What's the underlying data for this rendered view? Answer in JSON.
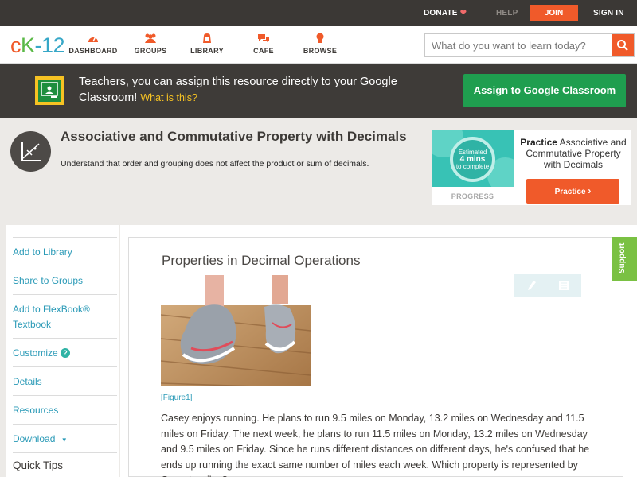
{
  "topbar": {
    "donate": "DONATE",
    "help": "HELP",
    "join": "JOIN",
    "signin": "SIGN IN"
  },
  "nav": {
    "logo": {
      "c": "c",
      "k": "K",
      "dash": "-",
      "n": "12"
    },
    "items": [
      {
        "label": "DASHBOARD",
        "icon": "speedometer-icon"
      },
      {
        "label": "GROUPS",
        "icon": "people-icon"
      },
      {
        "label": "LIBRARY",
        "icon": "book-bag-icon"
      },
      {
        "label": "CAFE",
        "icon": "chat-bubbles-icon"
      },
      {
        "label": "BROWSE",
        "icon": "lightbulb-icon"
      }
    ],
    "search_placeholder": "What do you want to learn today?"
  },
  "banner": {
    "text": "Teachers, you can assign this resource directly to your Google Classroom!",
    "what": "What is this?",
    "assign": "Assign to Google Classroom"
  },
  "concept": {
    "title": "Associative and Commutative Property with Decimals",
    "subtitle": "Understand that order and grouping does not affect the product or sum of decimals."
  },
  "practice": {
    "estimated": "Estimated",
    "mins": "4 mins",
    "tocomplete": "to complete",
    "progress": "PROGRESS",
    "bold": "Practice",
    "rest": "Associative and Commutative Property with Decimals",
    "button": "Practice"
  },
  "sidebar": {
    "items": [
      "Add to Library",
      "Share to Groups",
      "Add to FlexBook® Textbook",
      "Customize",
      "Details",
      "Resources",
      "Download"
    ],
    "quick_tips": "Quick Tips"
  },
  "article": {
    "title": "Properties in Decimal Operations",
    "figure": "[Figure1]",
    "paragraph": "Casey enjoys running. He plans to run 9.5 miles on Monday, 13.2 miles on Wednesday and 11.5 miles on Friday. The next week, he plans to run 11.5 miles on Monday, 13.2 miles on Wednesday and 9.5 miles on Friday. Since he runs different distances on different days, he's confused that he ends up running the exact same number of miles each week. Which property is represented by Casey's miles?"
  },
  "support": "Support",
  "colors": {
    "accent": "#f05a2a",
    "link": "#2a9ab7",
    "green": "#1f9e4f"
  }
}
